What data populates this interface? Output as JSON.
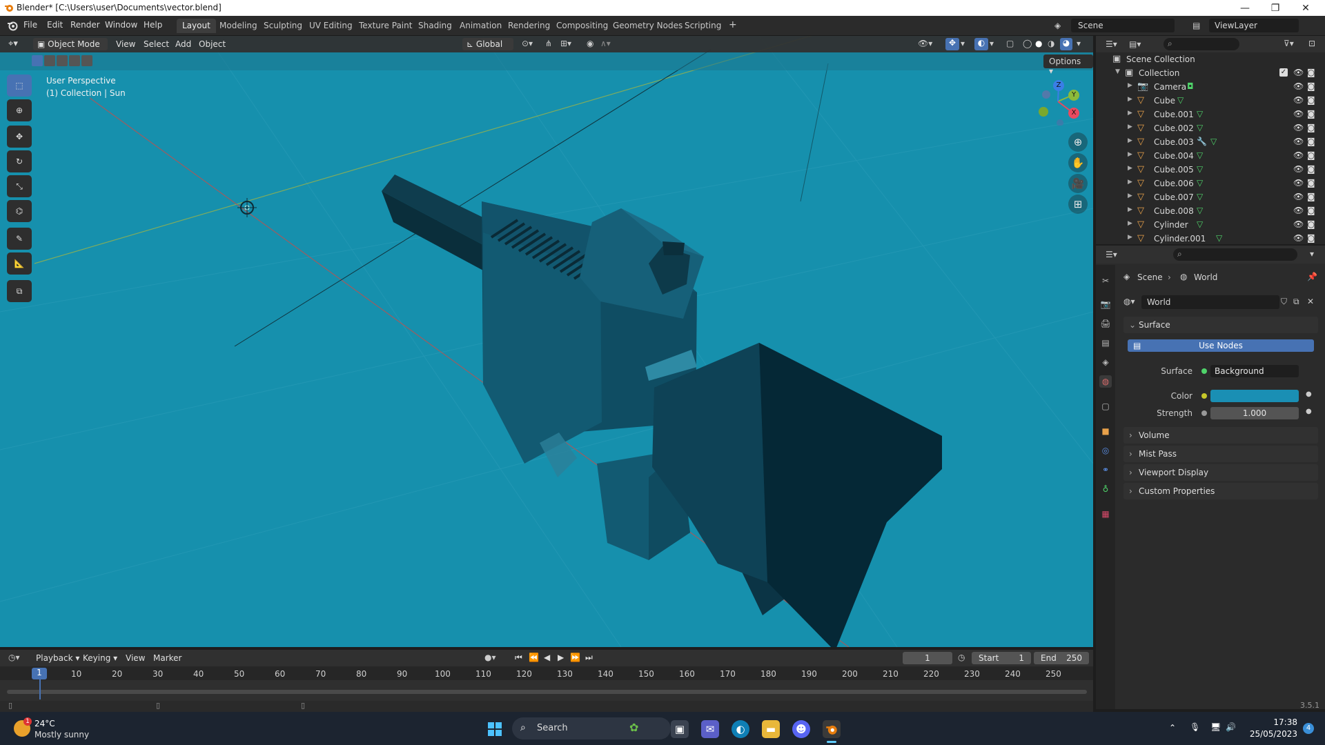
{
  "window": {
    "title": "Blender* [C:\\Users\\user\\Documents\\vector.blend]",
    "minimize": "—",
    "maximize": "❐",
    "close": "✕"
  },
  "menu": {
    "items": [
      "File",
      "Edit",
      "Render",
      "Window",
      "Help"
    ],
    "workspaces": [
      "Layout",
      "Modeling",
      "Sculpting",
      "UV Editing",
      "Texture Paint",
      "Shading",
      "Animation",
      "Rendering",
      "Compositing",
      "Geometry Nodes",
      "Scripting"
    ],
    "active_workspace": "Layout",
    "add_tab": "+",
    "scene": "Scene",
    "view_layer": "ViewLayer"
  },
  "viewport": {
    "mode": "Object Mode",
    "menus": [
      "View",
      "Select",
      "Add",
      "Object"
    ],
    "orientation": "Global",
    "options": "Options",
    "overlay_title": "User Perspective",
    "overlay_subtitle": "(1) Collection | Sun",
    "background_color": "#1690ad",
    "gizmo_axes": {
      "x": "X",
      "y": "Y",
      "z": "Z"
    }
  },
  "outliner": {
    "root": "Scene Collection",
    "collection": "Collection",
    "objects": [
      {
        "name": "Camera",
        "type": "camera"
      },
      {
        "name": "Cube",
        "type": "mesh"
      },
      {
        "name": "Cube.001",
        "type": "mesh"
      },
      {
        "name": "Cube.002",
        "type": "mesh"
      },
      {
        "name": "Cube.003",
        "type": "mesh-modifier"
      },
      {
        "name": "Cube.004",
        "type": "mesh"
      },
      {
        "name": "Cube.005",
        "type": "mesh"
      },
      {
        "name": "Cube.006",
        "type": "mesh"
      },
      {
        "name": "Cube.007",
        "type": "mesh"
      },
      {
        "name": "Cube.008",
        "type": "mesh"
      },
      {
        "name": "Cylinder",
        "type": "mesh"
      },
      {
        "name": "Cylinder.001",
        "type": "mesh"
      }
    ]
  },
  "properties": {
    "breadcrumb": [
      "Scene",
      "World"
    ],
    "world_name": "World",
    "surface_panel": "Surface",
    "use_nodes": "Use Nodes",
    "surface_label": "Surface",
    "surface_value": "Background",
    "color_label": "Color",
    "color_value": "#1a8fb4",
    "strength_label": "Strength",
    "strength_value": "1.000",
    "panels": [
      "Volume",
      "Mist Pass",
      "Viewport Display",
      "Custom Properties"
    ]
  },
  "timeline": {
    "menus": [
      "Playback",
      "Keying",
      "View",
      "Marker"
    ],
    "current_frame": "1",
    "start_label": "Start",
    "start": "1",
    "end_label": "End",
    "end": "250",
    "ticks": [
      "10",
      "20",
      "30",
      "40",
      "50",
      "60",
      "70",
      "80",
      "90",
      "100",
      "110",
      "120",
      "130",
      "140",
      "150",
      "160",
      "170",
      "180",
      "190",
      "200",
      "210",
      "220",
      "230",
      "240",
      "250"
    ],
    "frame_marker": "1"
  },
  "status": {
    "version": "3.5.1"
  },
  "taskbar": {
    "weather_temp": "24°C",
    "weather_desc": "Mostly sunny",
    "weather_badge": "1",
    "search": "Search",
    "time": "17:38",
    "date": "25/05/2023",
    "notification_count": "4"
  }
}
